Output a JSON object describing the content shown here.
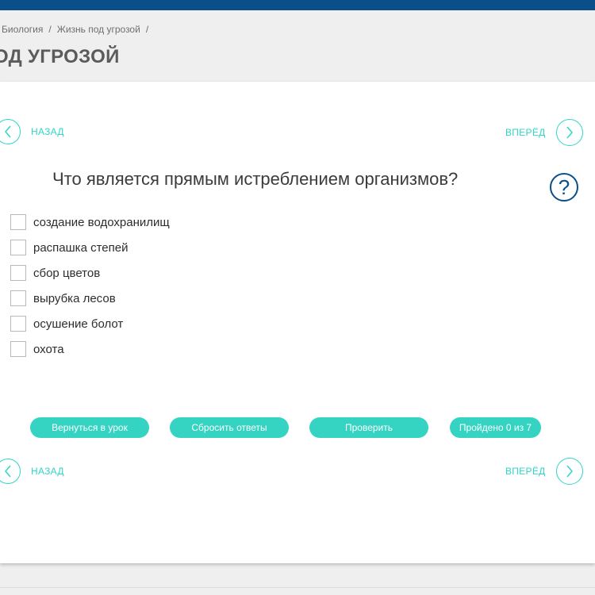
{
  "breadcrumb": {
    "items": [
      "Биология",
      "Жизнь под угрозой"
    ],
    "separator": "/"
  },
  "page": {
    "title": "ОД УГРОЗОЙ"
  },
  "nav": {
    "back_label": "НАЗАД",
    "forward_label": "ВПЕРЁД"
  },
  "question": {
    "text": "Что является прямым истреблением организмов?",
    "options": [
      {
        "label": "создание водохранилищ",
        "checked": false
      },
      {
        "label": "распашка степей",
        "checked": false
      },
      {
        "label": "сбор цветов",
        "checked": false
      },
      {
        "label": "вырубка лесов",
        "checked": false
      },
      {
        "label": "осушение болот",
        "checked": false
      },
      {
        "label": "охота",
        "checked": false
      }
    ]
  },
  "help": {
    "symbol": "?"
  },
  "actions": {
    "return_label": "Вернуться в урок",
    "reset_label": "Сбросить ответы",
    "check_label": "Проверить",
    "progress_label": "Пройдено 0 из 7"
  },
  "colors": {
    "accent": "#35d4c2",
    "header": "#0b4f8a",
    "background": "#efefef"
  }
}
